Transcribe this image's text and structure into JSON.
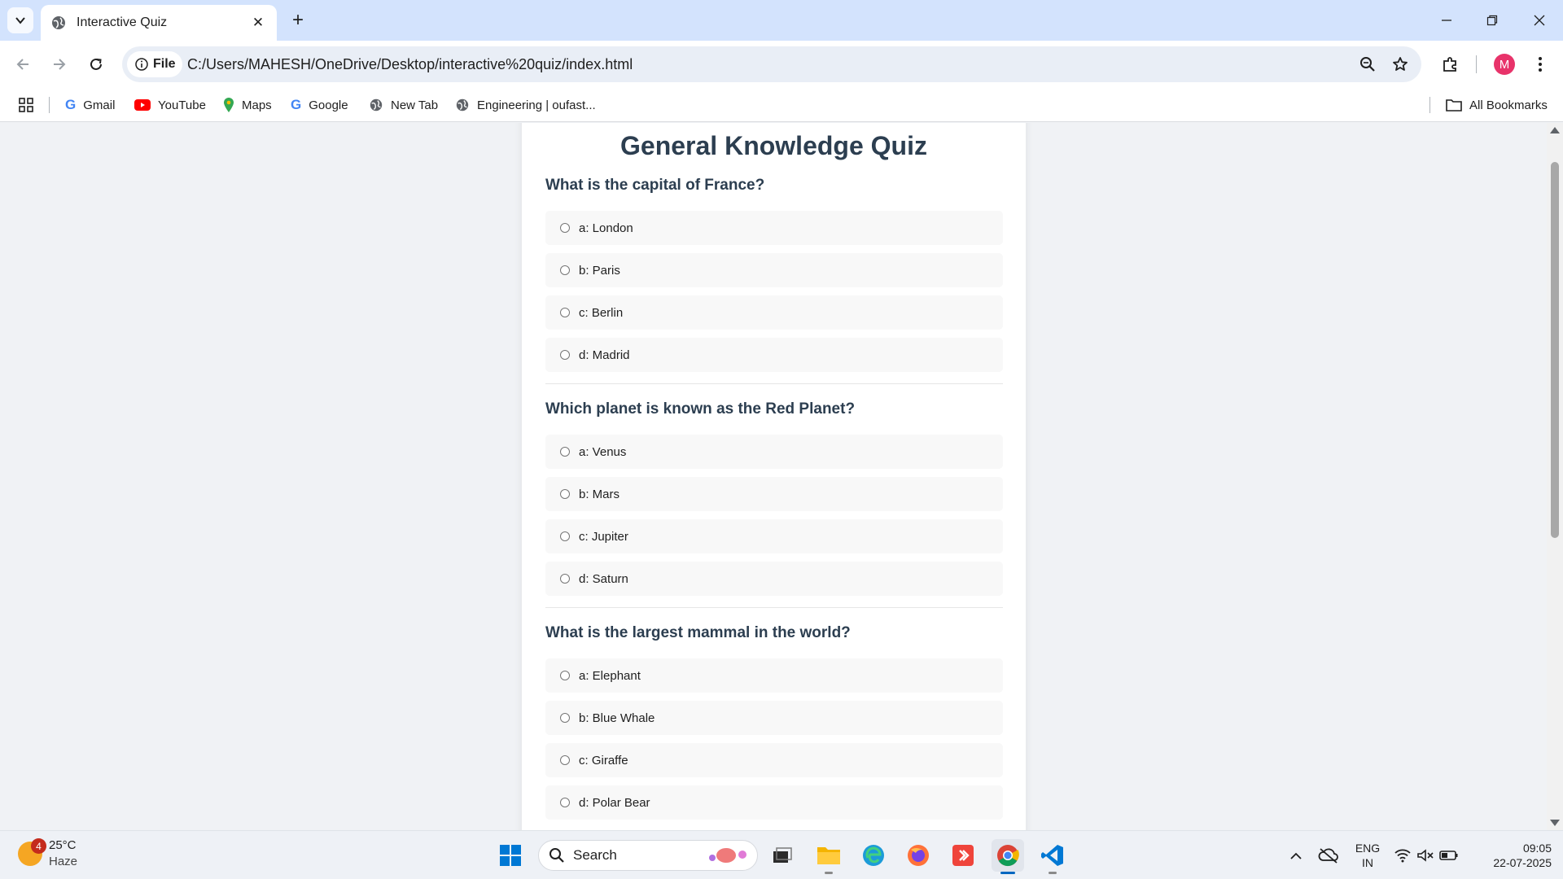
{
  "browser": {
    "tab_title": "Interactive Quiz",
    "address_chip": "File",
    "url": "C:/Users/MAHESH/OneDrive/Desktop/interactive%20quiz/index.html",
    "profile_initial": "M",
    "bookmarks": [
      {
        "label": "Gmail",
        "icon": "google-icon"
      },
      {
        "label": "YouTube",
        "icon": "youtube-icon"
      },
      {
        "label": "Maps",
        "icon": "maps-icon"
      },
      {
        "label": "Google",
        "icon": "google-icon"
      },
      {
        "label": "New Tab",
        "icon": "globe-icon"
      },
      {
        "label": "Engineering | oufast...",
        "icon": "globe-icon"
      }
    ],
    "all_bookmarks": "All Bookmarks"
  },
  "quiz": {
    "title": "General Knowledge Quiz",
    "questions": [
      {
        "text": "What is the capital of France?",
        "options": [
          "a: London",
          "b: Paris",
          "c: Berlin",
          "d: Madrid"
        ]
      },
      {
        "text": "Which planet is known as the Red Planet?",
        "options": [
          "a: Venus",
          "b: Mars",
          "c: Jupiter",
          "d: Saturn"
        ]
      },
      {
        "text": "What is the largest mammal in the world?",
        "options": [
          "a: Elephant",
          "b: Blue Whale",
          "c: Giraffe",
          "d: Polar Bear"
        ]
      }
    ]
  },
  "taskbar": {
    "weather_temp": "25°C",
    "weather_desc": "Haze",
    "weather_badge": "4",
    "search_placeholder": "Search",
    "language_line1": "ENG",
    "language_line2": "IN",
    "time": "09:05",
    "date": "22-07-2025"
  },
  "colors": {
    "tabstrip": "#d3e3fd",
    "heading": "#2c3e50",
    "option_bg": "#f8f8f8",
    "page_bg": "#f0f2f5"
  }
}
